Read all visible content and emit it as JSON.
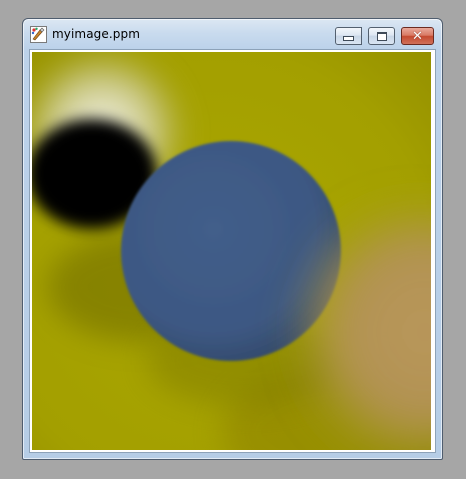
{
  "window": {
    "title": "myimage.ppm",
    "app_icon": "paint-icon",
    "caption_buttons": [
      {
        "name": "minimize",
        "icon": "minimize-icon"
      },
      {
        "name": "maximize",
        "icon": "maximize-icon"
      },
      {
        "name": "close",
        "icon": "close-icon",
        "glyph": "✕"
      }
    ]
  },
  "image": {
    "background_color": "#a5a200",
    "sphere_colors": {
      "blue": "#3f5a86",
      "tan": "#b8955a",
      "black": "#000000"
    }
  }
}
